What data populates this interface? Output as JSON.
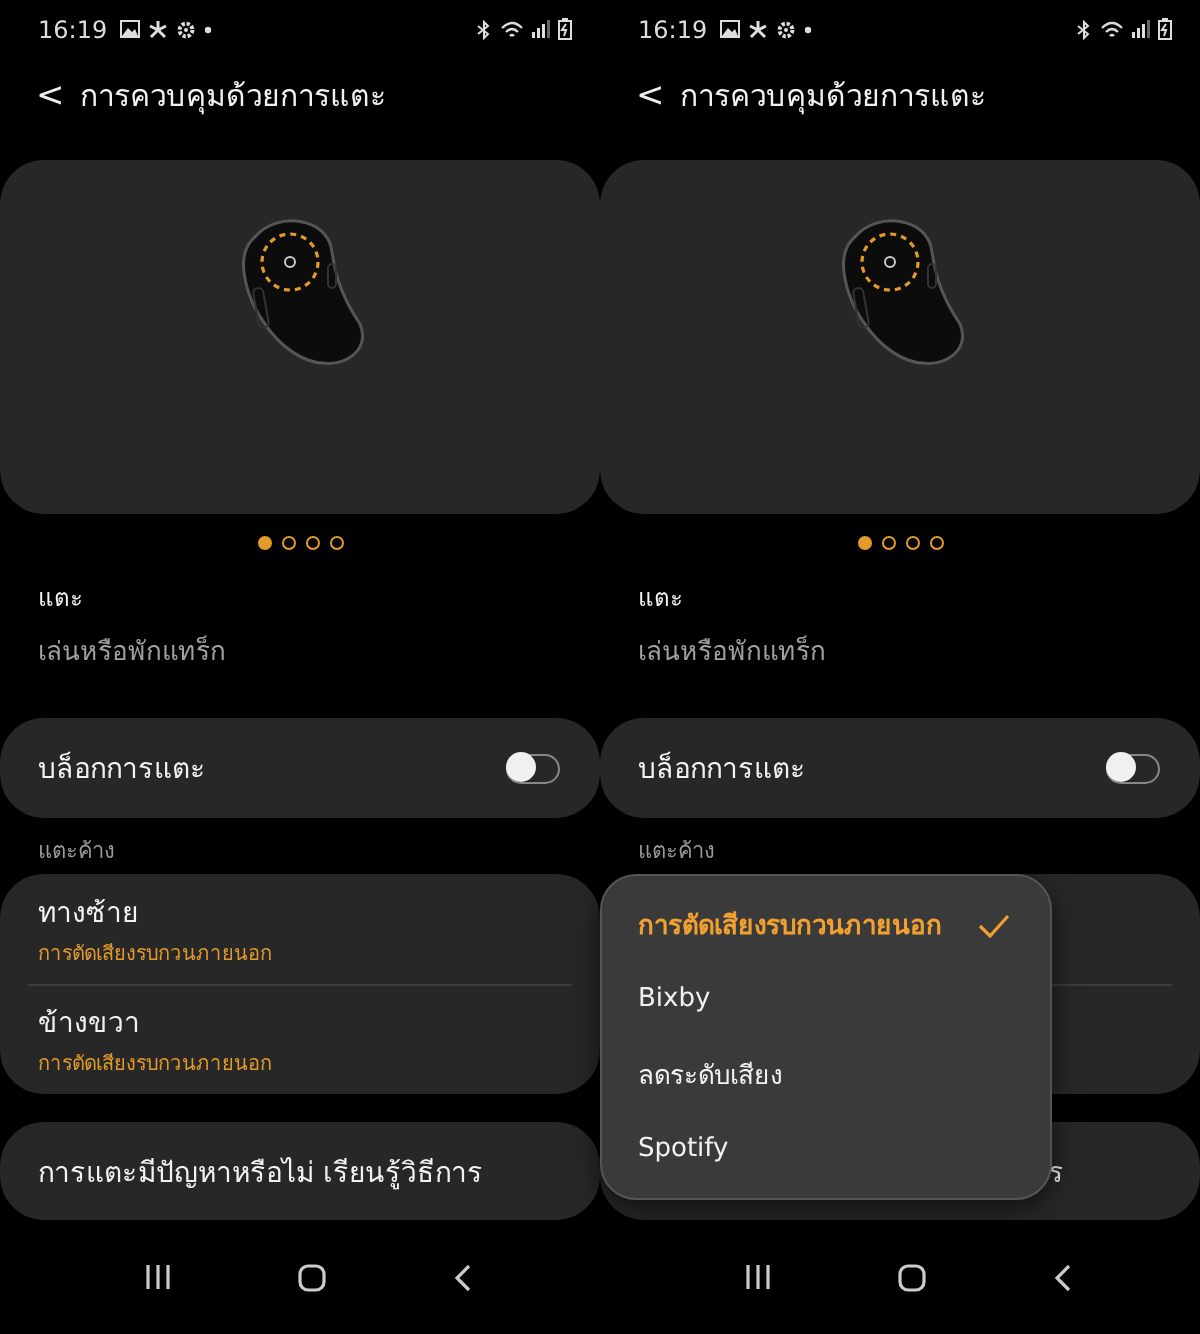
{
  "panels": [
    {
      "status_bar": {
        "time": "16:19"
      },
      "header": {
        "back": "<",
        "title": "การควบคุมด้วยการแตะ"
      },
      "page_dots": [
        {
          "selected": true
        },
        {
          "selected": false
        },
        {
          "selected": false
        },
        {
          "selected": false
        }
      ],
      "tap": {
        "label": "แตะ",
        "value": "เล่นหรือพักแทร็ก"
      },
      "block_toggle": {
        "label": "บล็อกการแตะ",
        "on": false
      },
      "section_label": "แตะค้าง",
      "long_press_items": [
        {
          "title": "ทางซ้าย",
          "value": "การตัดเสียงรบกวนภายนอก"
        },
        {
          "title": "ข้างขวา",
          "value": "การตัดเสียงรบกวนภายนอก"
        }
      ],
      "help_card": {
        "text": "การแตะมีปัญหาหรือไม่ เรียนรู้วิธีการ"
      }
    },
    {
      "status_bar": {
        "time": "16:19"
      },
      "header": {
        "back": "<",
        "title": "การควบคุมด้วยการแตะ"
      },
      "page_dots": [
        {
          "selected": true
        },
        {
          "selected": false
        },
        {
          "selected": false
        },
        {
          "selected": false
        }
      ],
      "tap": {
        "label": "แตะ",
        "value": "เล่นหรือพักแทร็ก"
      },
      "block_toggle": {
        "label": "บล็อกการแตะ",
        "on": false
      },
      "section_label": "แตะค้าง",
      "help_card": {
        "text": "ร"
      },
      "menu": {
        "items": [
          {
            "label": "การตัดเสียงรบกวนภายนอก",
            "selected": true
          },
          {
            "label": "Bixby",
            "selected": false
          },
          {
            "label": "ลดระดับเสียง",
            "selected": false
          },
          {
            "label": "Spotify",
            "selected": false
          }
        ]
      }
    }
  ]
}
